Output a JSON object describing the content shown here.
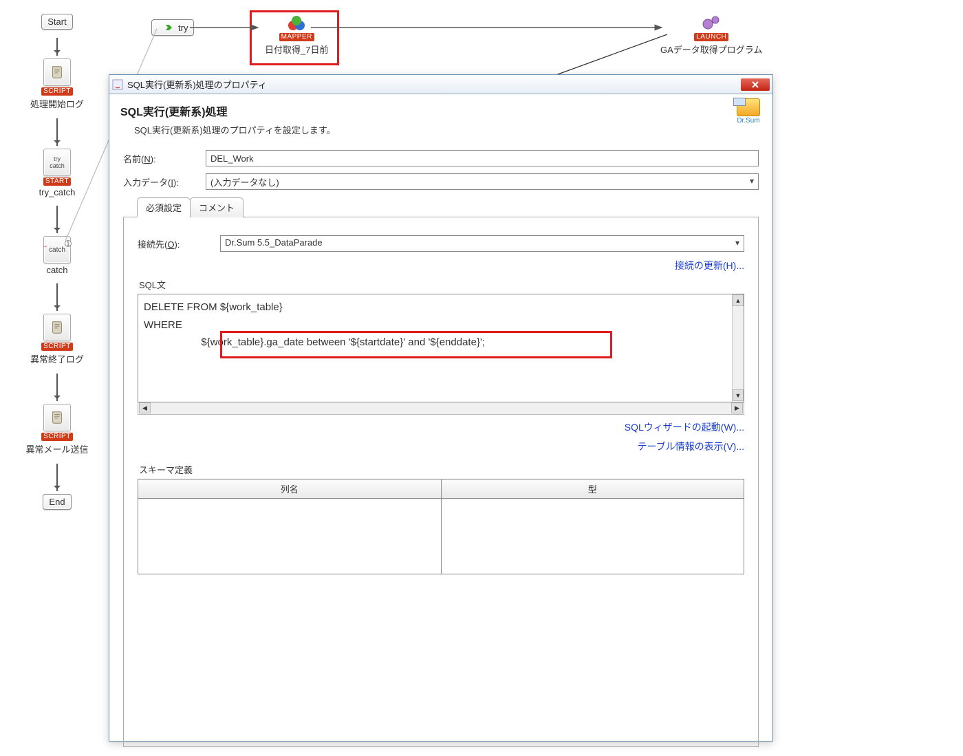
{
  "flow_left": {
    "start": "Start",
    "script_badge": "SCRIPT",
    "node_start_log": "処理開始ログ",
    "try_catch_badge": "START",
    "node_try_catch": "try_catch",
    "catch_icon_text": "catch",
    "node_catch": "catch",
    "node_error_log": "異常終了ログ",
    "node_error_mail": "異常メール送信",
    "end": "End"
  },
  "flow_top": {
    "try": "try",
    "mapper_badge": "MAPPER",
    "mapper_label": "日付取得_7日前",
    "launch_badge": "LAUNCH",
    "launch_label": "GAデータ取得プログラム"
  },
  "dialog": {
    "title": "SQL実行(更新系)処理のプロパティ",
    "heading": "SQL実行(更新系)処理",
    "subheading": "SQL実行(更新系)処理のプロパティを設定します。",
    "drsum_label": "Dr.Sum",
    "name_label_pre": "名前(",
    "name_key": "N",
    "name_label_post": "):",
    "name_value": "DEL_Work",
    "input_label_pre": "入力データ(",
    "input_key": "I",
    "input_label_post": "):",
    "input_value": "(入力データなし)",
    "tab_required": "必須設定",
    "tab_comment": "コメント",
    "conn_label_pre": "接続先(",
    "conn_key": "O",
    "conn_label_post": "):",
    "conn_value": "Dr.Sum 5.5_DataParade",
    "conn_refresh_pre": "接続の更新(",
    "conn_refresh_key": "H",
    "conn_refresh_post": ")...",
    "sql_label": "SQL文",
    "sql_text": "DELETE FROM ${work_table}\nWHERE\n                    ${work_table}.ga_date between '${startdate}' and '${enddate}';",
    "wizard_pre": "SQLウィザードの起動(",
    "wizard_key": "W",
    "wizard_post": ")...",
    "tinfo_pre": "テーブル情報の表示(",
    "tinfo_key": "V",
    "tinfo_post": ")...",
    "schema_label": "スキーマ定義",
    "col_name": "列名",
    "col_type": "型"
  }
}
